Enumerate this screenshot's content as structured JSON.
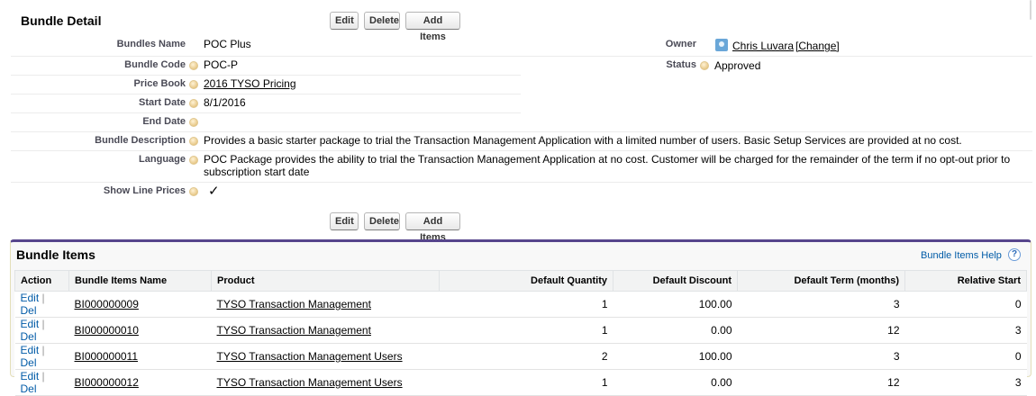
{
  "detail": {
    "title": "Bundle Detail",
    "buttons": {
      "edit": "Edit",
      "delete": "Delete",
      "add_items": "Add Items"
    },
    "fields": {
      "bundles_name": {
        "label": "Bundles Name",
        "value": "POC Plus"
      },
      "bundle_code": {
        "label": "Bundle Code",
        "value": "POC-P"
      },
      "price_book": {
        "label": "Price Book",
        "value": "2016 TYSO Pricing"
      },
      "start_date": {
        "label": "Start Date",
        "value": "8/1/2016"
      },
      "end_date": {
        "label": "End Date",
        "value": ""
      },
      "bundle_description": {
        "label": "Bundle Description",
        "value": "Provides a basic starter package to trial the Transaction Management Application with a limited number of users. Basic Setup Services are provided at no cost."
      },
      "language": {
        "label": "Language",
        "value": "POC Package provides the ability to trial the Transaction Management Application at no cost. Customer will be charged for the remainder of the term if no opt-out prior to subscription start date"
      },
      "show_line_prices": {
        "label": "Show Line Prices",
        "value": "✓"
      },
      "owner": {
        "label": "Owner",
        "value": "Chris Luvara",
        "change": "[Change]"
      },
      "status": {
        "label": "Status",
        "value": "Approved"
      }
    }
  },
  "bundle_items": {
    "title": "Bundle Items",
    "help": "Bundle Items Help",
    "help_icon": "?",
    "columns": [
      "Action",
      "Bundle Items Name",
      "Product",
      "Default Quantity",
      "Default Discount",
      "Default Term (months)",
      "Relative Start"
    ],
    "action_edit": "Edit",
    "action_sep": "|",
    "action_del": "Del",
    "rows": [
      {
        "name": "BI000000009",
        "product": "TYSO Transaction Management",
        "quantity": "1",
        "discount": "100.00",
        "term": "3",
        "relative_start": "0"
      },
      {
        "name": "BI000000010",
        "product": "TYSO Transaction Management",
        "quantity": "1",
        "discount": "0.00",
        "term": "12",
        "relative_start": "3"
      },
      {
        "name": "BI000000011",
        "product": "TYSO Transaction Management Users",
        "quantity": "2",
        "discount": "100.00",
        "term": "3",
        "relative_start": "0"
      },
      {
        "name": "BI000000012",
        "product": "TYSO Transaction Management Users",
        "quantity": "1",
        "discount": "0.00",
        "term": "12",
        "relative_start": "3"
      }
    ]
  },
  "colors": {
    "accent": "#56458c",
    "link": "#015ba7"
  }
}
